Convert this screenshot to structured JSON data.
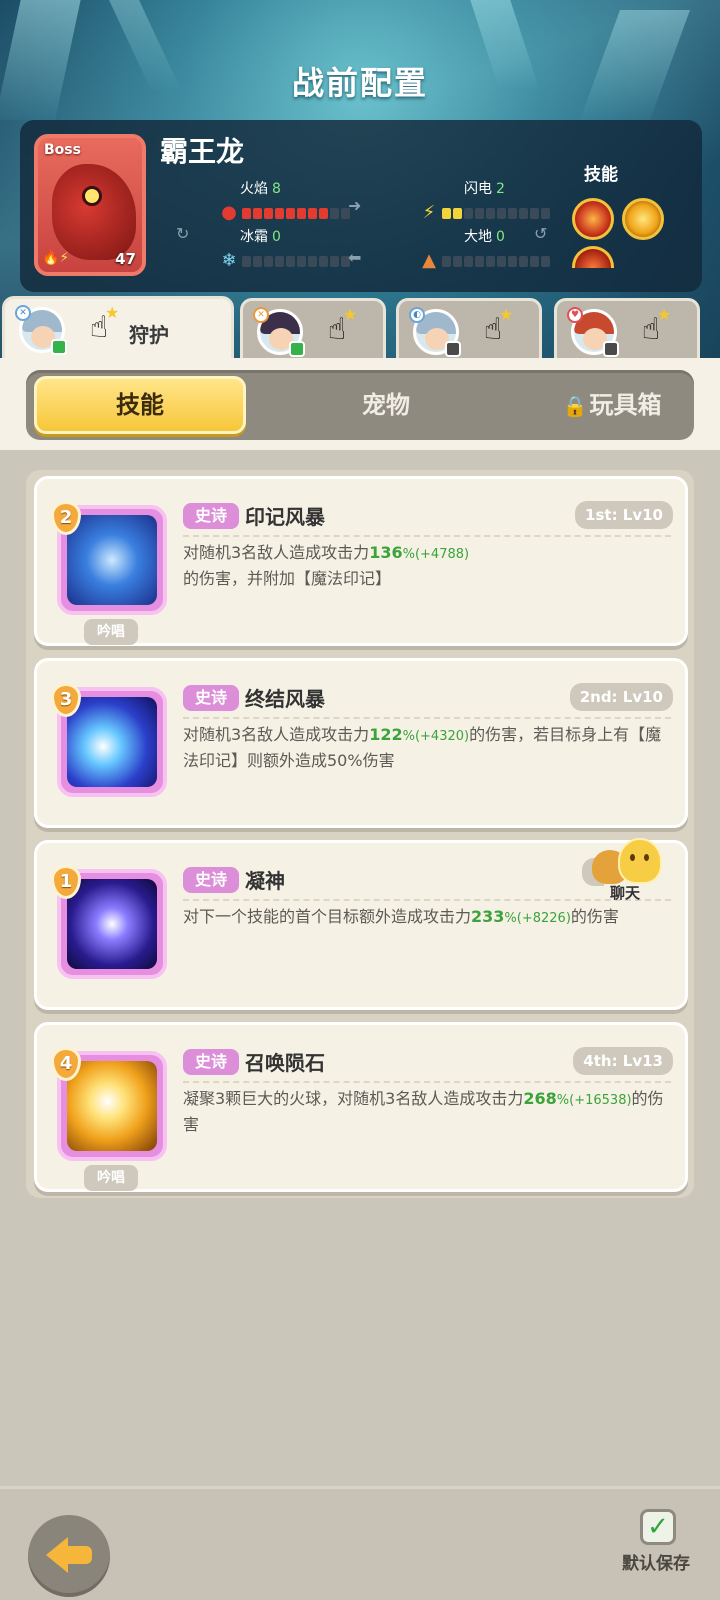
{
  "header": {
    "title": "战前配置"
  },
  "boss": {
    "badge": "Boss",
    "name": "霸王龙",
    "level": "47",
    "stats": {
      "fire": {
        "label": "火焰",
        "value": "8",
        "level": 8,
        "max": 10
      },
      "light": {
        "label": "闪电",
        "value": "2",
        "level": 2,
        "max": 10
      },
      "ice": {
        "label": "冰霜",
        "value": "0",
        "level": 0,
        "max": 10
      },
      "earth": {
        "label": "大地",
        "value": "0",
        "level": 0,
        "max": 10
      }
    },
    "skills_label": "技能"
  },
  "hero_tabs": [
    {
      "label": "狩护",
      "active": true,
      "status": "online"
    },
    {
      "label": "",
      "active": false,
      "status": "online"
    },
    {
      "label": "",
      "active": false,
      "status": "offline"
    },
    {
      "label": "",
      "active": false,
      "status": "offline"
    }
  ],
  "tabs": [
    {
      "label": "技能",
      "active": true
    },
    {
      "label": "宠物",
      "active": false
    },
    {
      "label": "玩具箱",
      "active": false,
      "locked": true
    }
  ],
  "skills": [
    {
      "order": "2",
      "rarity": "史诗",
      "name": "印记风暴",
      "slot": "1st: Lv10",
      "chant": "吟唱",
      "desc_a": "对随机3名敌人造成攻击力",
      "pct": "136",
      "bonus": "(+4788)",
      "desc_b": "的伤害，并附加【魔法印记】"
    },
    {
      "order": "3",
      "rarity": "史诗",
      "name": "终结风暴",
      "slot": "2nd: Lv10",
      "chant": "",
      "desc_a": "对随机3名敌人造成攻击力",
      "pct": "122",
      "bonus": "(+4320)",
      "desc_b": "的伤害，若目标身上有【魔法印记】则额外造成50%伤害"
    },
    {
      "order": "1",
      "rarity": "史诗",
      "name": "凝神",
      "slot": "",
      "chant": "",
      "desc_a": "对下一个技能的首个目标额外造成攻击力",
      "pct": "233",
      "bonus": "(+8226)",
      "desc_b": "的伤害"
    },
    {
      "order": "4",
      "rarity": "史诗",
      "name": "召唤陨石",
      "slot": "4th: Lv13",
      "chant": "吟唱",
      "desc_a": "凝聚3颗巨大的火球，对随机3名敌人造成攻击力",
      "pct": "268",
      "bonus": "(+16538)",
      "desc_b": "的伤害"
    }
  ],
  "chat": {
    "label": "聊天"
  },
  "footer": {
    "save_label": "默认保存"
  },
  "colors": {
    "accent": "#f7c73a",
    "epic": "#dc8fd8",
    "bonus_green": "#3ca33a",
    "fire": "#e23b2f",
    "lightning": "#f2d43a"
  }
}
